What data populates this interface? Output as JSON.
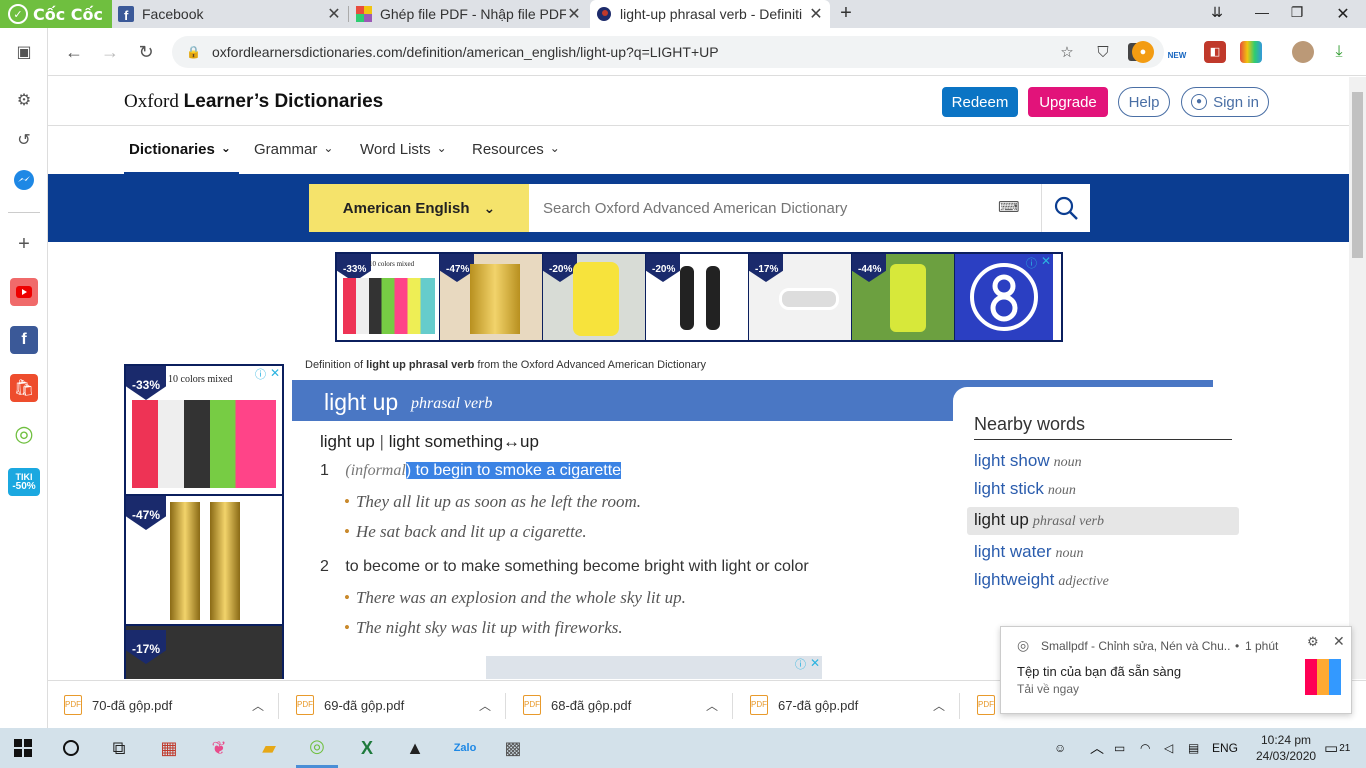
{
  "browser": {
    "brand_tab": "Cốc Cốc",
    "tabs": [
      {
        "title": "Facebook",
        "icon": "facebook-icon"
      },
      {
        "title": "Ghép file PDF - Nhập file PDF",
        "icon": "pdf-icon"
      },
      {
        "title": "light-up phrasal verb - Definiti",
        "icon": "oxford-icon"
      }
    ],
    "new_tab": "+",
    "url": "oxfordlearnersdictionaries.com/definition/american_english/light-up?q=LIGHT+UP",
    "ext_new_badge": "NEW"
  },
  "site": {
    "logo_regular": "Oxford ",
    "logo_bold": "Learner’s Dictionaries",
    "redeem": "Redeem",
    "upgrade": "Upgrade",
    "help": "Help",
    "sign_in": "Sign in",
    "nav": [
      "Dictionaries",
      "Grammar",
      "Word Lists",
      "Resources"
    ],
    "language": "American English",
    "search_placeholder": "Search Oxford Advanced American Dictionary"
  },
  "ads": {
    "strip_discounts": [
      "-33%",
      "-47%",
      "-20%",
      "-20%",
      "-17%",
      "-44%"
    ],
    "strip_first_caption": "10 colors mixed",
    "side_discounts": [
      "-33%",
      "-47%",
      "-17%"
    ],
    "side_first_caption": "10 colors mixed"
  },
  "entry": {
    "crumb_prefix": "Definition of ",
    "crumb_bold": "light up phrasal verb",
    "crumb_suffix": " from the Oxford Advanced American Dictionary",
    "headword": "light up",
    "pos": "phrasal verb",
    "forms_a": "light up",
    "forms_sep": " | ",
    "forms_b": "light something↔up",
    "senses": [
      {
        "num": "1",
        "label": "(informal",
        "label_hl": ")",
        "def": " to begin to smoke a cigarette",
        "examples": [
          "They all lit up as soon as he left the room.",
          "He sat back and lit up a cigarette."
        ]
      },
      {
        "num": "2",
        "def": "to become or to make something become bright with light or color",
        "examples": [
          "There was an explosion and the whole sky lit up.",
          "The night sky was lit up with fireworks."
        ]
      }
    ]
  },
  "nearby": {
    "title": "Nearby words",
    "items": [
      {
        "word": "light show",
        "pos": "noun"
      },
      {
        "word": "light stick",
        "pos": "noun"
      },
      {
        "word": "light up",
        "pos": "phrasal verb"
      },
      {
        "word": "light water",
        "pos": "noun"
      },
      {
        "word": "lightweight",
        "pos": "adjective"
      }
    ]
  },
  "downloads": [
    "70-đã gộp.pdf",
    "69-đã gộp.pdf",
    "68-đã gộp.pdf",
    "67-đã gộp.pdf"
  ],
  "notification": {
    "source": "Smallpdf - Chỉnh sửa, Nén và Chu...",
    "dot": "•",
    "time": "1 phút",
    "title": "Tệp tin của bạn đã sẵn sàng",
    "body": "Tải về ngay"
  },
  "taskbar": {
    "lang": "ENG",
    "time": "10:24 pm",
    "date": "24/03/2020",
    "notif_count": "21"
  },
  "sidebar_badges": {
    "tiki_line1": "TIKI",
    "tiki_line2": "-50%"
  }
}
